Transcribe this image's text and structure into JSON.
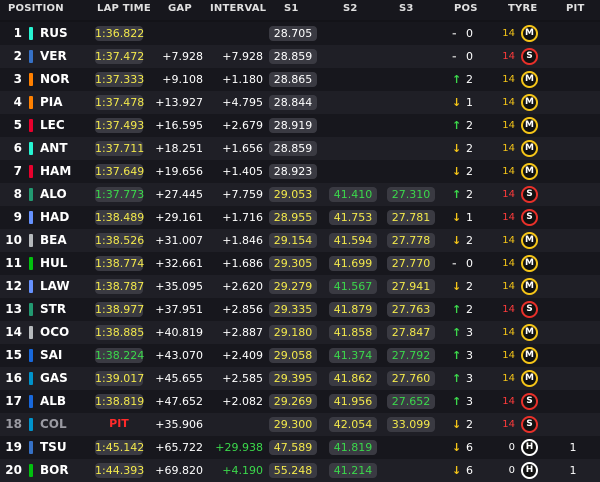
{
  "headers": {
    "position": "POSITION",
    "lap_time": "LAP TIME",
    "gap": "GAP",
    "interval": "INTERVAL",
    "s1": "S1",
    "s2": "S2",
    "s3": "S3",
    "pos": "POS",
    "tyre": "TYRE",
    "pit": "PIT"
  },
  "colors": {
    "lap_yellow": "#f3e94b",
    "fastest_green": "#3bd84b",
    "pit_red": "#ff2a2a",
    "medium_ring": "#f5c518",
    "soft_ring": "#e8302a",
    "hard_ring": "#ffffff"
  },
  "rows": [
    {
      "pos": "1",
      "code": "RUS",
      "team_color": "#27f4d2",
      "lap": "1:36.822",
      "lap_color": "yellow",
      "gap": "",
      "interval": "",
      "s1": "28.705",
      "s1_color": "white",
      "s2": "",
      "s2_color": "white",
      "s3": "",
      "s3_color": "white",
      "arrow": "-",
      "change": "0",
      "tyre_age": "14",
      "tyre_age_color": "yellow",
      "tyre": "M",
      "pit": ""
    },
    {
      "pos": "2",
      "code": "VER",
      "team_color": "#3671c6",
      "lap": "1:37.472",
      "lap_color": "yellow",
      "gap": "+7.928",
      "interval": "+7.928",
      "s1": "28.859",
      "s1_color": "white",
      "s2": "",
      "s2_color": "white",
      "s3": "",
      "s3_color": "white",
      "arrow": "-",
      "change": "0",
      "tyre_age": "14",
      "tyre_age_color": "red",
      "tyre": "S",
      "pit": ""
    },
    {
      "pos": "3",
      "code": "NOR",
      "team_color": "#ff8000",
      "lap": "1:37.333",
      "lap_color": "yellow",
      "gap": "+9.108",
      "interval": "+1.180",
      "s1": "28.865",
      "s1_color": "white",
      "s2": "",
      "s2_color": "white",
      "s3": "",
      "s3_color": "white",
      "arrow": "↑",
      "change": "2",
      "tyre_age": "14",
      "tyre_age_color": "yellow",
      "tyre": "M",
      "pit": ""
    },
    {
      "pos": "4",
      "code": "PIA",
      "team_color": "#ff8000",
      "lap": "1:37.478",
      "lap_color": "yellow",
      "gap": "+13.927",
      "interval": "+4.795",
      "s1": "28.844",
      "s1_color": "white",
      "s2": "",
      "s2_color": "white",
      "s3": "",
      "s3_color": "white",
      "arrow": "↓",
      "change": "1",
      "tyre_age": "14",
      "tyre_age_color": "yellow",
      "tyre": "M",
      "pit": ""
    },
    {
      "pos": "5",
      "code": "LEC",
      "team_color": "#e8002d",
      "lap": "1:37.493",
      "lap_color": "yellow",
      "gap": "+16.595",
      "interval": "+2.679",
      "s1": "28.919",
      "s1_color": "white",
      "s2": "",
      "s2_color": "white",
      "s3": "",
      "s3_color": "white",
      "arrow": "↑",
      "change": "2",
      "tyre_age": "14",
      "tyre_age_color": "yellow",
      "tyre": "M",
      "pit": ""
    },
    {
      "pos": "6",
      "code": "ANT",
      "team_color": "#27f4d2",
      "lap": "1:37.711",
      "lap_color": "yellow",
      "gap": "+18.251",
      "interval": "+1.656",
      "s1": "28.859",
      "s1_color": "white",
      "s2": "",
      "s2_color": "white",
      "s3": "",
      "s3_color": "white",
      "arrow": "↓",
      "change": "2",
      "tyre_age": "14",
      "tyre_age_color": "yellow",
      "tyre": "M",
      "pit": ""
    },
    {
      "pos": "7",
      "code": "HAM",
      "team_color": "#e8002d",
      "lap": "1:37.649",
      "lap_color": "yellow",
      "gap": "+19.656",
      "interval": "+1.405",
      "s1": "28.923",
      "s1_color": "white",
      "s2": "",
      "s2_color": "white",
      "s3": "",
      "s3_color": "white",
      "arrow": "↓",
      "change": "2",
      "tyre_age": "14",
      "tyre_age_color": "yellow",
      "tyre": "M",
      "pit": ""
    },
    {
      "pos": "8",
      "code": "ALO",
      "team_color": "#229971",
      "lap": "1:37.773",
      "lap_color": "green",
      "gap": "+27.445",
      "interval": "+7.759",
      "s1": "29.053",
      "s1_color": "yellow",
      "s2": "41.410",
      "s2_color": "green",
      "s3": "27.310",
      "s3_color": "green",
      "arrow": "↑",
      "change": "2",
      "tyre_age": "14",
      "tyre_age_color": "red",
      "tyre": "S",
      "pit": ""
    },
    {
      "pos": "9",
      "code": "HAD",
      "team_color": "#6692ff",
      "lap": "1:38.489",
      "lap_color": "yellow",
      "gap": "+29.161",
      "interval": "+1.716",
      "s1": "28.955",
      "s1_color": "yellow",
      "s2": "41.753",
      "s2_color": "yellow",
      "s3": "27.781",
      "s3_color": "yellow",
      "arrow": "↓",
      "change": "1",
      "tyre_age": "14",
      "tyre_age_color": "red",
      "tyre": "S",
      "pit": ""
    },
    {
      "pos": "10",
      "code": "BEA",
      "team_color": "#b6babd",
      "lap": "1:38.526",
      "lap_color": "yellow",
      "gap": "+31.007",
      "interval": "+1.846",
      "s1": "29.154",
      "s1_color": "yellow",
      "s2": "41.594",
      "s2_color": "yellow",
      "s3": "27.778",
      "s3_color": "yellow",
      "arrow": "↓",
      "change": "2",
      "tyre_age": "14",
      "tyre_age_color": "yellow",
      "tyre": "M",
      "pit": ""
    },
    {
      "pos": "11",
      "code": "HUL",
      "team_color": "#01c00e",
      "lap": "1:38.774",
      "lap_color": "yellow",
      "gap": "+32.661",
      "interval": "+1.686",
      "s1": "29.305",
      "s1_color": "yellow",
      "s2": "41.699",
      "s2_color": "yellow",
      "s3": "27.770",
      "s3_color": "yellow",
      "arrow": "-",
      "change": "0",
      "tyre_age": "14",
      "tyre_age_color": "yellow",
      "tyre": "M",
      "pit": ""
    },
    {
      "pos": "12",
      "code": "LAW",
      "team_color": "#6692ff",
      "lap": "1:38.787",
      "lap_color": "yellow",
      "gap": "+35.095",
      "interval": "+2.620",
      "s1": "29.279",
      "s1_color": "yellow",
      "s2": "41.567",
      "s2_color": "green",
      "s3": "27.941",
      "s3_color": "yellow",
      "arrow": "↓",
      "change": "2",
      "tyre_age": "14",
      "tyre_age_color": "yellow",
      "tyre": "M",
      "pit": ""
    },
    {
      "pos": "13",
      "code": "STR",
      "team_color": "#229971",
      "lap": "1:38.977",
      "lap_color": "yellow",
      "gap": "+37.951",
      "interval": "+2.856",
      "s1": "29.335",
      "s1_color": "yellow",
      "s2": "41.879",
      "s2_color": "yellow",
      "s3": "27.763",
      "s3_color": "yellow",
      "arrow": "↑",
      "change": "2",
      "tyre_age": "14",
      "tyre_age_color": "red",
      "tyre": "S",
      "pit": ""
    },
    {
      "pos": "14",
      "code": "OCO",
      "team_color": "#b6babd",
      "lap": "1:38.885",
      "lap_color": "yellow",
      "gap": "+40.819",
      "interval": "+2.887",
      "s1": "29.180",
      "s1_color": "yellow",
      "s2": "41.858",
      "s2_color": "yellow",
      "s3": "27.847",
      "s3_color": "yellow",
      "arrow": "↑",
      "change": "3",
      "tyre_age": "14",
      "tyre_age_color": "yellow",
      "tyre": "M",
      "pit": ""
    },
    {
      "pos": "15",
      "code": "SAI",
      "team_color": "#1868db",
      "lap": "1:38.224",
      "lap_color": "green",
      "gap": "+43.070",
      "interval": "+2.409",
      "s1": "29.058",
      "s1_color": "yellow",
      "s2": "41.374",
      "s2_color": "green",
      "s3": "27.792",
      "s3_color": "green",
      "arrow": "↑",
      "change": "3",
      "tyre_age": "14",
      "tyre_age_color": "yellow",
      "tyre": "M",
      "pit": ""
    },
    {
      "pos": "16",
      "code": "GAS",
      "team_color": "#0093cc",
      "lap": "1:39.017",
      "lap_color": "yellow",
      "gap": "+45.655",
      "interval": "+2.585",
      "s1": "29.395",
      "s1_color": "yellow",
      "s2": "41.862",
      "s2_color": "yellow",
      "s3": "27.760",
      "s3_color": "yellow",
      "arrow": "↑",
      "change": "3",
      "tyre_age": "14",
      "tyre_age_color": "yellow",
      "tyre": "M",
      "pit": ""
    },
    {
      "pos": "17",
      "code": "ALB",
      "team_color": "#1868db",
      "lap": "1:38.819",
      "lap_color": "yellow",
      "gap": "+47.652",
      "interval": "+2.082",
      "s1": "29.269",
      "s1_color": "yellow",
      "s2": "41.956",
      "s2_color": "yellow",
      "s3": "27.652",
      "s3_color": "green",
      "arrow": "↑",
      "change": "3",
      "tyre_age": "14",
      "tyre_age_color": "red",
      "tyre": "S",
      "pit": ""
    },
    {
      "pos": "18",
      "code": "COL",
      "team_color": "#0093cc",
      "dim": true,
      "lap": "PIT",
      "lap_color": "pit",
      "gap": "+35.906",
      "interval": "",
      "s1": "29.300",
      "s1_color": "yellow",
      "s2": "42.054",
      "s2_color": "yellow",
      "s3": "33.099",
      "s3_color": "yellow",
      "arrow": "↓",
      "change": "2",
      "tyre_age": "14",
      "tyre_age_color": "red",
      "tyre": "S",
      "pit": ""
    },
    {
      "pos": "19",
      "code": "TSU",
      "team_color": "#3671c6",
      "lap": "1:45.142",
      "lap_color": "yellow",
      "gap": "+65.722",
      "interval": "+29.938",
      "interval_color": "green",
      "s1": "47.589",
      "s1_color": "yellow",
      "s2": "41.819",
      "s2_color": "green",
      "s3": "",
      "s3_color": "white",
      "arrow": "↓",
      "change": "6",
      "tyre_age": "0",
      "tyre_age_color": "white",
      "tyre": "H",
      "pit": "1"
    },
    {
      "pos": "20",
      "code": "BOR",
      "team_color": "#01c00e",
      "lap": "1:44.393",
      "lap_color": "yellow",
      "gap": "+69.820",
      "interval": "+4.190",
      "interval_color": "green",
      "s1": "55.248",
      "s1_color": "yellow",
      "s2": "41.214",
      "s2_color": "green",
      "s3": "",
      "s3_color": "white",
      "arrow": "↓",
      "change": "6",
      "tyre_age": "0",
      "tyre_age_color": "white",
      "tyre": "H",
      "pit": "1"
    }
  ]
}
